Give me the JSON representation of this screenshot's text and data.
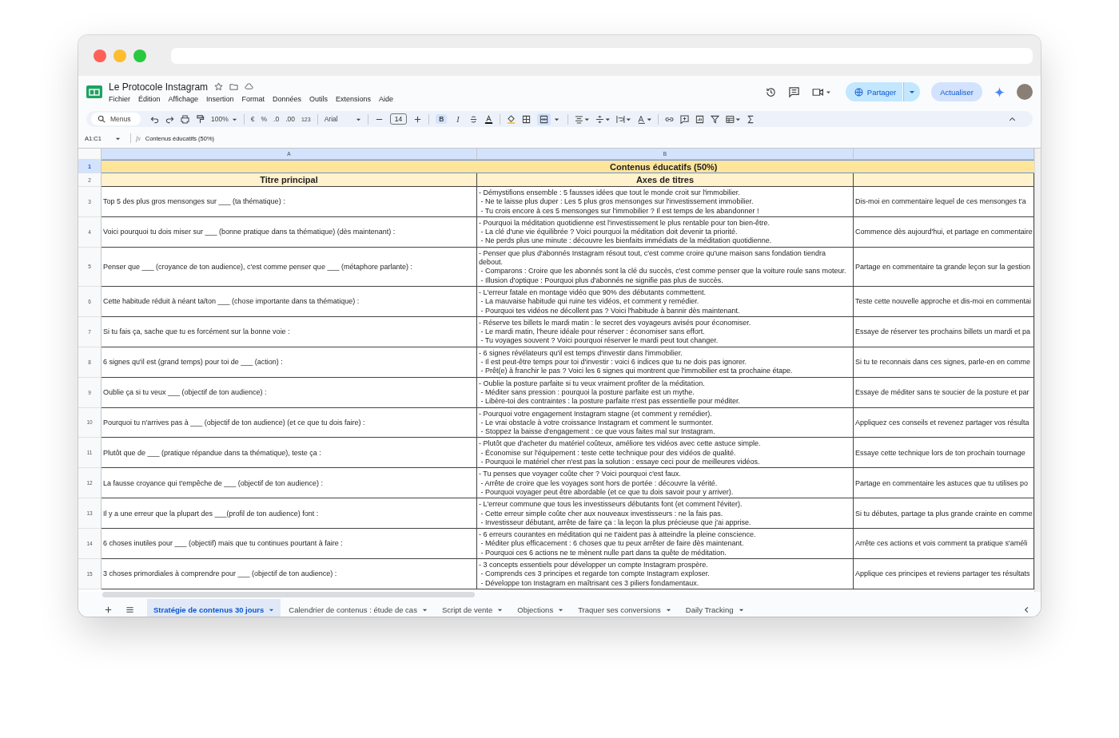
{
  "document": {
    "title": "Le Protocole Instagram",
    "starred": false
  },
  "menu": [
    "Fichier",
    "Édition",
    "Affichage",
    "Insertion",
    "Format",
    "Données",
    "Outils",
    "Extensions",
    "Aide"
  ],
  "header_buttons": {
    "share": "Partager",
    "update": "Actualiser"
  },
  "toolbar": {
    "search": "Menus",
    "zoom": "100%",
    "currency": "€",
    "percent": "%",
    "decrease_decimals": ".0",
    "increase_decimals": ".00",
    "number_format": "123",
    "font": "Arial",
    "font_size": "14",
    "bold": {
      "label": "B",
      "selected": true
    },
    "italic": {
      "label": "I",
      "selected": false
    },
    "merge": {
      "selected": true
    }
  },
  "formula_bar": {
    "cell_ref": "A1:C1",
    "fx": "fx",
    "content": "Contenus éducatifs (50%)"
  },
  "columns": [
    {
      "label": "A",
      "selected": true
    },
    {
      "label": "B",
      "selected": true
    }
  ],
  "section_row": {
    "number": "1",
    "selected": true,
    "title": "Contenus éducatifs (50%)"
  },
  "header_row": {
    "number": "2",
    "selected": false,
    "headers": [
      "Titre principal",
      "Axes de titres"
    ]
  },
  "rows": [
    {
      "number": "3",
      "title": "Top 5 des plus gros mensonges sur ___ (ta thématique) :",
      "axes": [
        "- Démystifions ensemble : 5 fausses idées que tout le monde croit sur l'immobilier.",
        " - Ne te laisse plus duper : Les 5 plus gros mensonges sur l'investissement immobilier.",
        " - Tu crois encore à ces 5 mensonges sur l'immobilier ? Il est temps de les abandonner !"
      ],
      "column_3": "Dis-moi en commentaire lequel de ces mensonges t'a"
    },
    {
      "number": "4",
      "title": "Voici pourquoi tu dois miser sur ___ (bonne pratique dans ta thématique) (dès maintenant) :",
      "axes": [
        "- Pourquoi la méditation quotidienne est l'investissement le plus rentable pour ton bien-être.",
        " - La clé d'une vie équilibrée ? Voici pourquoi la méditation doit devenir ta priorité.",
        " - Ne perds plus une minute : découvre les bienfaits immédiats de la méditation quotidienne."
      ],
      "column_3": "Commence dès aujourd'hui, et partage en commentaire"
    },
    {
      "number": "5",
      "title": "Penser que ___ (croyance de ton audience), c'est comme penser que ___ (métaphore parlante) :",
      "axes": [
        "- Penser que plus d'abonnés Instagram résout tout, c'est comme croire qu'une maison sans fondation tiendra debout.",
        " - Comparons : Croire que les abonnés sont la clé du succès, c'est comme penser que la voiture roule sans moteur.",
        " - Illusion d'optique : Pourquoi plus d'abonnés ne signifie pas plus de succès."
      ],
      "column_3": "Partage en commentaire ta grande leçon sur la gestion"
    },
    {
      "number": "6",
      "title": "Cette habitude réduit à néant ta/ton ___ (chose importante dans ta thématique) :",
      "axes": [
        "- L'erreur fatale en montage vidéo que 90% des débutants commettent.",
        " - La mauvaise habitude qui ruine tes vidéos, et comment y remédier.",
        " - Pourquoi tes vidéos ne décollent pas ? Voici l'habitude à bannir dès maintenant."
      ],
      "column_3": "Teste cette nouvelle approche et dis-moi en commentai"
    },
    {
      "number": "7",
      "title": "Si tu fais ça, sache que tu es forcément sur la bonne voie :",
      "axes": [
        "- Réserve tes billets le mardi matin : le secret des voyageurs avisés pour économiser.",
        " - Le mardi matin, l'heure idéale pour réserver : économiser sans effort.",
        " - Tu voyages souvent ? Voici pourquoi réserver le mardi peut tout changer."
      ],
      "column_3": "Essaye de réserver tes prochains billets un mardi et pa"
    },
    {
      "number": "8",
      "title": "6 signes qu'il est (grand temps) pour toi de ___ (action) :",
      "axes": [
        "- 6 signes révélateurs qu'il est temps d'investir dans l'immobilier.",
        " - Il est peut-être temps pour toi d'investir : voici 6 indices que tu ne dois pas ignorer.",
        " - Prêt(e) à franchir le pas ? Voici les 6 signes qui montrent que l'immobilier est ta prochaine étape."
      ],
      "column_3": "Si tu te reconnais dans ces signes, parle-en en comme"
    },
    {
      "number": "9",
      "title": "Oublie ça si tu veux ___ (objectif de ton audience) :",
      "axes": [
        "- Oublie la posture parfaite si tu veux vraiment profiter de la méditation.",
        " - Méditer sans pression : pourquoi la posture parfaite est un mythe.",
        " - Libère-toi des contraintes : la posture parfaite n'est pas essentielle pour méditer."
      ],
      "column_3": "Essaye de méditer sans te soucier de la posture et par"
    },
    {
      "number": "10",
      "title": "Pourquoi tu n'arrives pas à ___ (objectif de ton audience) (et ce que tu dois faire) :",
      "axes": [
        "- Pourquoi votre engagement Instagram stagne (et comment y remédier).",
        " - Le vrai obstacle à votre croissance Instagram et comment le surmonter.",
        " - Stoppez la baisse d'engagement : ce que vous faites mal sur Instagram."
      ],
      "column_3": "Appliquez ces conseils et revenez partager vos résulta"
    },
    {
      "number": "11",
      "title": "Plutôt que de ___ (pratique répandue dans ta thématique), teste ça :",
      "axes": [
        "- Plutôt que d'acheter du matériel coûteux, améliore tes vidéos avec cette astuce simple.",
        " - Économise sur l'équipement : teste cette technique pour des vidéos de qualité.",
        " - Pourquoi le matériel cher n'est pas la solution : essaye ceci pour de meilleures vidéos."
      ],
      "column_3": "Essaye cette technique lors de ton prochain tournage"
    },
    {
      "number": "12",
      "title": "La fausse croyance qui t'empêche de ___ (objectif de ton audience) :",
      "axes": [
        "- Tu penses que voyager coûte cher ? Voici pourquoi c'est faux.",
        " - Arrête de croire que les voyages sont hors de portée : découvre la vérité.",
        " - Pourquoi voyager peut être abordable (et ce que tu dois savoir pour y arriver)."
      ],
      "column_3": "Partage en commentaire les astuces que tu utilises po"
    },
    {
      "number": "13",
      "title": "Il y a une erreur que la plupart des ___(profil de ton audience) font :",
      "axes": [
        "- L'erreur commune que tous les investisseurs débutants font (et comment l'éviter).",
        " - Cette erreur simple coûte cher aux nouveaux investisseurs : ne la fais pas.",
        " - Investisseur débutant, arrête de faire ça : la leçon la plus précieuse que j'ai apprise."
      ],
      "column_3": "Si tu débutes, partage ta plus grande crainte en comme"
    },
    {
      "number": "14",
      "title": "6 choses inutiles pour ___ (objectif) mais que tu continues pourtant à faire :",
      "axes": [
        "- 6 erreurs courantes en méditation qui ne t'aident pas à atteindre la pleine conscience.",
        " - Méditer plus efficacement : 6 choses que tu peux arrêter de faire dès maintenant.",
        " - Pourquoi ces 6 actions ne te mènent nulle part dans ta quête de méditation."
      ],
      "column_3": "Arrête ces actions et vois comment ta pratique s'améli"
    },
    {
      "number": "15",
      "title": "3 choses primordiales à comprendre pour ___ (objectif de ton audience) :",
      "axes": [
        "- 3 concepts essentiels pour développer un compte Instagram prospère.",
        " - Comprends ces 3 principes et regarde ton compte Instagram exploser.",
        " - Développe ton Instagram en maîtrisant ces 3 piliers fondamentaux."
      ],
      "column_3": "Applique ces principes et reviens partager tes résultats"
    }
  ],
  "sheet_tabs": [
    {
      "label": "Stratégie de contenus 30 jours",
      "selected": true
    },
    {
      "label": "Calendrier de contenus : étude de cas",
      "selected": false
    },
    {
      "label": "Script de vente",
      "selected": false
    },
    {
      "label": "Objections",
      "selected": false
    },
    {
      "label": "Traquer ses conversions",
      "selected": false
    },
    {
      "label": "Daily Tracking",
      "selected": false
    }
  ]
}
